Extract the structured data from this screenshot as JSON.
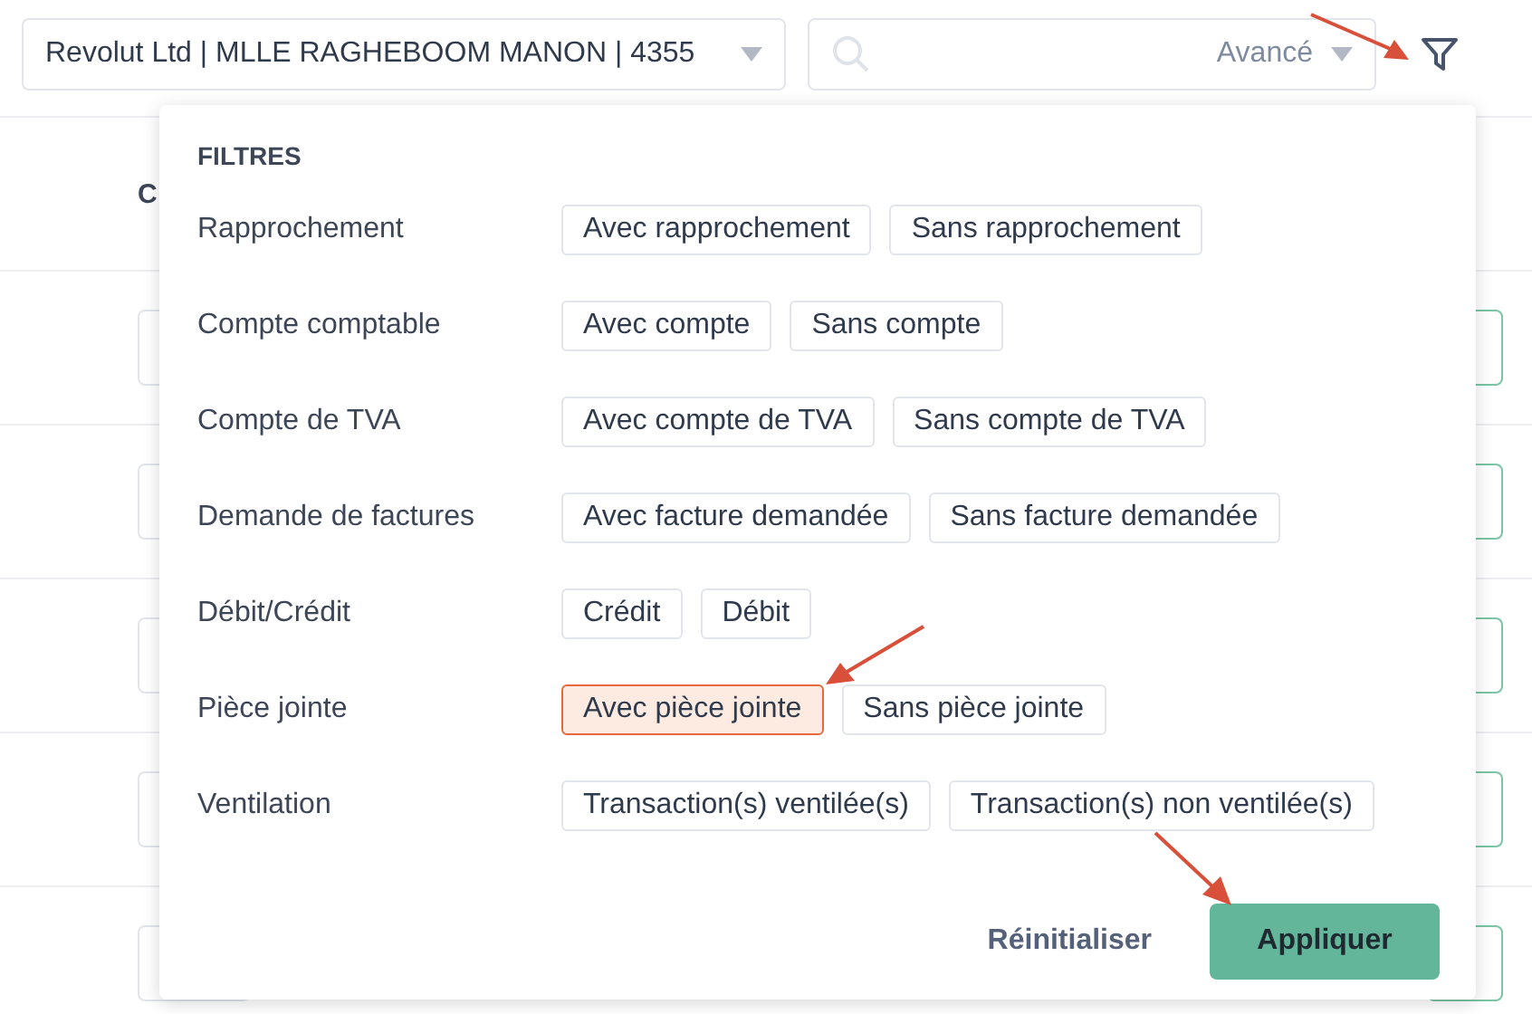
{
  "account_select": {
    "value": "Revolut Ltd | MLLE RAGHEBOOM MANON | 4355"
  },
  "search": {
    "mode": "Avancé"
  },
  "table": {
    "column_1": "C"
  },
  "filters": {
    "title": "FILTRES",
    "groups": [
      {
        "label": "Rapprochement",
        "options": [
          {
            "label": "Avec rapprochement",
            "selected": false
          },
          {
            "label": "Sans rapprochement",
            "selected": false
          }
        ]
      },
      {
        "label": "Compte comptable",
        "options": [
          {
            "label": "Avec compte",
            "selected": false
          },
          {
            "label": "Sans compte",
            "selected": false
          }
        ]
      },
      {
        "label": "Compte de TVA",
        "options": [
          {
            "label": "Avec compte de TVA",
            "selected": false
          },
          {
            "label": "Sans compte de TVA",
            "selected": false
          }
        ]
      },
      {
        "label": "Demande de factures",
        "options": [
          {
            "label": "Avec facture demandée",
            "selected": false
          },
          {
            "label": "Sans facture demandée",
            "selected": false
          }
        ]
      },
      {
        "label": "Débit/Crédit",
        "options": [
          {
            "label": "Crédit",
            "selected": false
          },
          {
            "label": "Débit",
            "selected": false
          }
        ]
      },
      {
        "label": "Pièce jointe",
        "options": [
          {
            "label": "Avec pièce jointe",
            "selected": true
          },
          {
            "label": "Sans pièce jointe",
            "selected": false
          }
        ]
      },
      {
        "label": "Ventilation",
        "options": [
          {
            "label": "Transaction(s) ventilée(s)",
            "selected": false
          },
          {
            "label": "Transaction(s) non ventilée(s)",
            "selected": false
          }
        ]
      }
    ],
    "reset": "Réinitialiser",
    "apply": "Appliquer"
  }
}
